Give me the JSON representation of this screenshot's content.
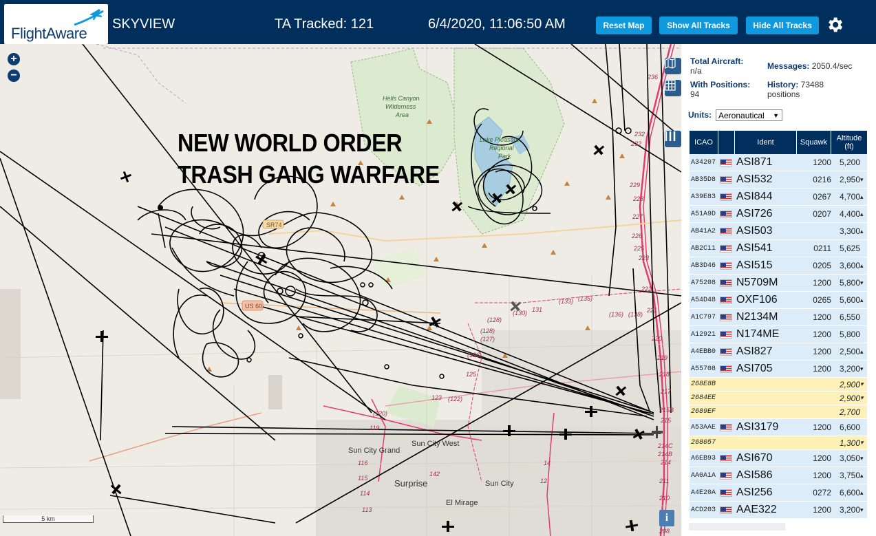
{
  "header": {
    "logo_text": "FlightAware",
    "app_title": "SKYVIEW",
    "ta_tracked": "TA Tracked: 121",
    "datetime": "6/4/2020, 11:06:50 AM",
    "reset_map": "Reset Map",
    "show_all_tracks": "Show All Tracks",
    "hide_all_tracks": "Hide All Tracks",
    "settings_icon": "gear-icon"
  },
  "map": {
    "zoom_in": "+",
    "zoom_out": "−",
    "overlay_line1": "NEW WORLD ORDER",
    "overlay_line2": "TRASH GANG WARFARE",
    "place_labels": [
      "Hells Canyon",
      "Wilderness",
      "Area",
      "Lake Pleasant",
      "Regional",
      "Park",
      "Sun City Grand",
      "Sun City West",
      "Surprise",
      "Sun City",
      "El Mirage",
      "US 60",
      "SR74"
    ],
    "road_numbers": [
      "236",
      "232",
      "232",
      "229",
      "228",
      "227",
      "226",
      "225",
      "223",
      "222",
      "221",
      "220",
      "219",
      "218",
      "217",
      "215B",
      "215",
      "214C",
      "214B",
      "214",
      "212",
      "211",
      "210",
      "209",
      "208",
      "131",
      "(133)",
      "(135)",
      "(136)",
      "(138)",
      "(130)",
      "(128)",
      "(128)",
      "(126)",
      "125",
      "123",
      "119",
      "116",
      "115",
      "114",
      "113",
      "142",
      "14",
      "12",
      "(128)",
      "(127)"
    ],
    "info_icon": "i",
    "scale_label": "5 km"
  },
  "panel": {
    "total_aircraft_label": "Total Aircraft:",
    "total_aircraft_value": "n/a",
    "with_positions_label": "With Positions:",
    "with_positions_value": "94",
    "messages_label": "Messages:",
    "messages_value": "2050.4/sec",
    "history_label": "History:",
    "history_value": "73488",
    "history_unit": "positions",
    "units_label": "Units:",
    "units_value": "Aeronautical",
    "columns": [
      "ICAO",
      "Ident",
      "Squawk",
      "Altitude (ft)"
    ],
    "rows": [
      {
        "icao": "A34207",
        "flag": true,
        "ident": "ASI871",
        "squawk": "1200",
        "alt": "5,200",
        "trend": "",
        "highlight": false
      },
      {
        "icao": "AB35D8",
        "flag": true,
        "ident": "ASI532",
        "squawk": "0216",
        "alt": "2,950",
        "trend": "▾",
        "highlight": false
      },
      {
        "icao": "A39E83",
        "flag": true,
        "ident": "ASI844",
        "squawk": "0267",
        "alt": "4,700",
        "trend": "▴",
        "highlight": false
      },
      {
        "icao": "A51A9D",
        "flag": true,
        "ident": "ASI726",
        "squawk": "0207",
        "alt": "4,400",
        "trend": "▴",
        "highlight": false
      },
      {
        "icao": "AB41A2",
        "flag": true,
        "ident": "ASI503",
        "squawk": "",
        "alt": "3,300",
        "trend": "▴",
        "highlight": false
      },
      {
        "icao": "AB2C11",
        "flag": true,
        "ident": "ASI541",
        "squawk": "0211",
        "alt": "5,625",
        "trend": "",
        "highlight": false
      },
      {
        "icao": "AB3D46",
        "flag": true,
        "ident": "ASI515",
        "squawk": "0205",
        "alt": "3,600",
        "trend": "▴",
        "highlight": false
      },
      {
        "icao": "A75208",
        "flag": true,
        "ident": "N5709M",
        "squawk": "1200",
        "alt": "5,800",
        "trend": "▾",
        "highlight": false
      },
      {
        "icao": "A54D48",
        "flag": true,
        "ident": "OXF106",
        "squawk": "0265",
        "alt": "5,600",
        "trend": "▴",
        "highlight": false
      },
      {
        "icao": "A1C797",
        "flag": true,
        "ident": "N2134M",
        "squawk": "1200",
        "alt": "6,550",
        "trend": "",
        "highlight": false
      },
      {
        "icao": "A12921",
        "flag": true,
        "ident": "N174ME",
        "squawk": "1200",
        "alt": "5,800",
        "trend": "",
        "highlight": false
      },
      {
        "icao": "A4EBB0",
        "flag": true,
        "ident": "ASI827",
        "squawk": "1200",
        "alt": "2,500",
        "trend": "▴",
        "highlight": false
      },
      {
        "icao": "A55708",
        "flag": true,
        "ident": "ASI705",
        "squawk": "1200",
        "alt": "3,200",
        "trend": "▾",
        "highlight": false
      },
      {
        "icao": "268E8B",
        "flag": false,
        "ident": "",
        "squawk": "",
        "alt": "2,900",
        "trend": "▾",
        "highlight": true
      },
      {
        "icao": "2684EE",
        "flag": false,
        "ident": "",
        "squawk": "",
        "alt": "2,900",
        "trend": "▾",
        "highlight": true
      },
      {
        "icao": "2689EF",
        "flag": false,
        "ident": "",
        "squawk": "",
        "alt": "2,700",
        "trend": "",
        "highlight": true
      },
      {
        "icao": "A53AAE",
        "flag": true,
        "ident": "ASI3179",
        "squawk": "1200",
        "alt": "6,600",
        "trend": "",
        "highlight": false
      },
      {
        "icao": "268057",
        "flag": false,
        "ident": "",
        "squawk": "",
        "alt": "1,300",
        "trend": "▾",
        "highlight": true
      },
      {
        "icao": "A6EB93",
        "flag": true,
        "ident": "ASI670",
        "squawk": "1200",
        "alt": "3,050",
        "trend": "▾",
        "highlight": false
      },
      {
        "icao": "AA0A1A",
        "flag": true,
        "ident": "ASI586",
        "squawk": "1200",
        "alt": "3,750",
        "trend": "▴",
        "highlight": false
      },
      {
        "icao": "A4E20A",
        "flag": true,
        "ident": "ASI256",
        "squawk": "0272",
        "alt": "6,600",
        "trend": "▴",
        "highlight": false
      },
      {
        "icao": "ACD203",
        "flag": true,
        "ident": "AAE322",
        "squawk": "1200",
        "alt": "3,200",
        "trend": "▾",
        "highlight": false
      }
    ]
  }
}
